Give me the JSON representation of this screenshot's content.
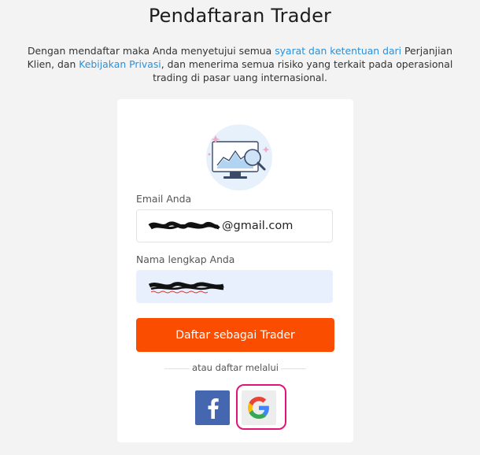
{
  "page": {
    "title": "Pendaftaran Trader",
    "intro_before": "Dengan mendaftar maka Anda menyetujui semua ",
    "intro_link1": "syarat dan ketentuan dari",
    "intro_middle": " Perjanjian Klien, dan ",
    "intro_link2": "Kebijakan Privasi",
    "intro_after": ", dan menerima semua risiko yang terkait pada operasional trading di pasar uang internasional."
  },
  "form": {
    "email_label": "Email Anda",
    "email_value_visible": "@gmail.com",
    "name_label": "Nama lengkap Anda",
    "submit_label": "Daftar sebagai Trader",
    "alt_signup": "atau daftar melalui"
  },
  "social": {
    "facebook_letter": "f",
    "icons": [
      "chart-monitor-illustration",
      "facebook-icon",
      "google-icon"
    ]
  },
  "colors": {
    "accent": "#fb4d00",
    "link": "#2d8fd8",
    "facebook": "#4467b0",
    "highlight_ring": "#e0157a"
  }
}
